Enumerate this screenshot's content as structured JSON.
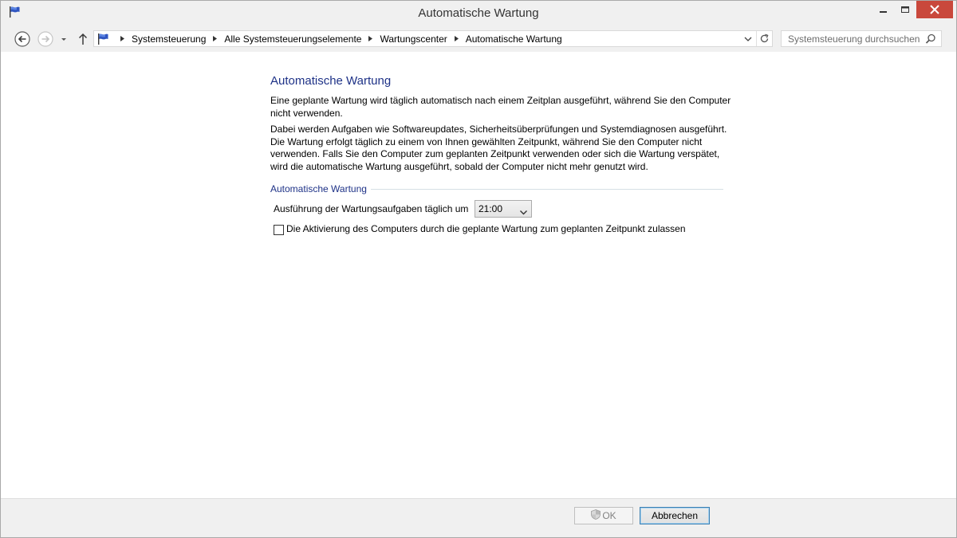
{
  "window": {
    "title": "Automatische Wartung",
    "app_icon": "maintenance-flag-icon"
  },
  "window_controls": {
    "minimize_icon": "minimize-icon",
    "maximize_icon": "maximize-icon",
    "close_icon": "close-icon",
    "close_color": "#c9483c"
  },
  "navigation": {
    "back_icon": "back-arrow-icon",
    "forward_icon": "forward-arrow-icon",
    "recent_icon": "chevron-down-icon",
    "up_icon": "up-arrow-icon",
    "breadcrumbs": [
      "Systemsteuerung",
      "Alle Systemsteuerungselemente",
      "Wartungscenter",
      "Automatische Wartung"
    ],
    "search_placeholder": "Systemsteuerung durchsuchen"
  },
  "main": {
    "heading": "Automatische Wartung",
    "intro": "Eine geplante Wartung wird täglich automatisch nach einem Zeitplan ausgeführt, während Sie den Computer nicht verwenden.",
    "description": "Dabei werden Aufgaben wie Softwareupdates, Sicherheitsüberprüfungen und Systemdiagnosen ausgeführt. Die Wartung erfolgt täglich zu einem von Ihnen gewählten Zeitpunkt, während Sie den Computer nicht verwenden. Falls Sie den Computer zum geplanten Zeitpunkt verwenden oder sich die Wartung verspätet, wird die automatische Wartung ausgeführt, sobald der Computer nicht mehr genutzt wird.",
    "group_title": "Automatische Wartung",
    "time_label": "Ausführung der Wartungsaufgaben täglich um",
    "time_value": "21:00",
    "wake_checkbox_label": "Die Aktivierung des Computers durch die geplante Wartung zum geplanten Zeitpunkt zulassen",
    "wake_checkbox_checked": false
  },
  "footer": {
    "ok_label": "OK",
    "ok_icon": "uac-shield-icon",
    "cancel_label": "Abbrechen"
  },
  "colors": {
    "heading": "#1e3287",
    "chrome": "#f0f0f0",
    "focus_border": "#3c7fb1"
  }
}
